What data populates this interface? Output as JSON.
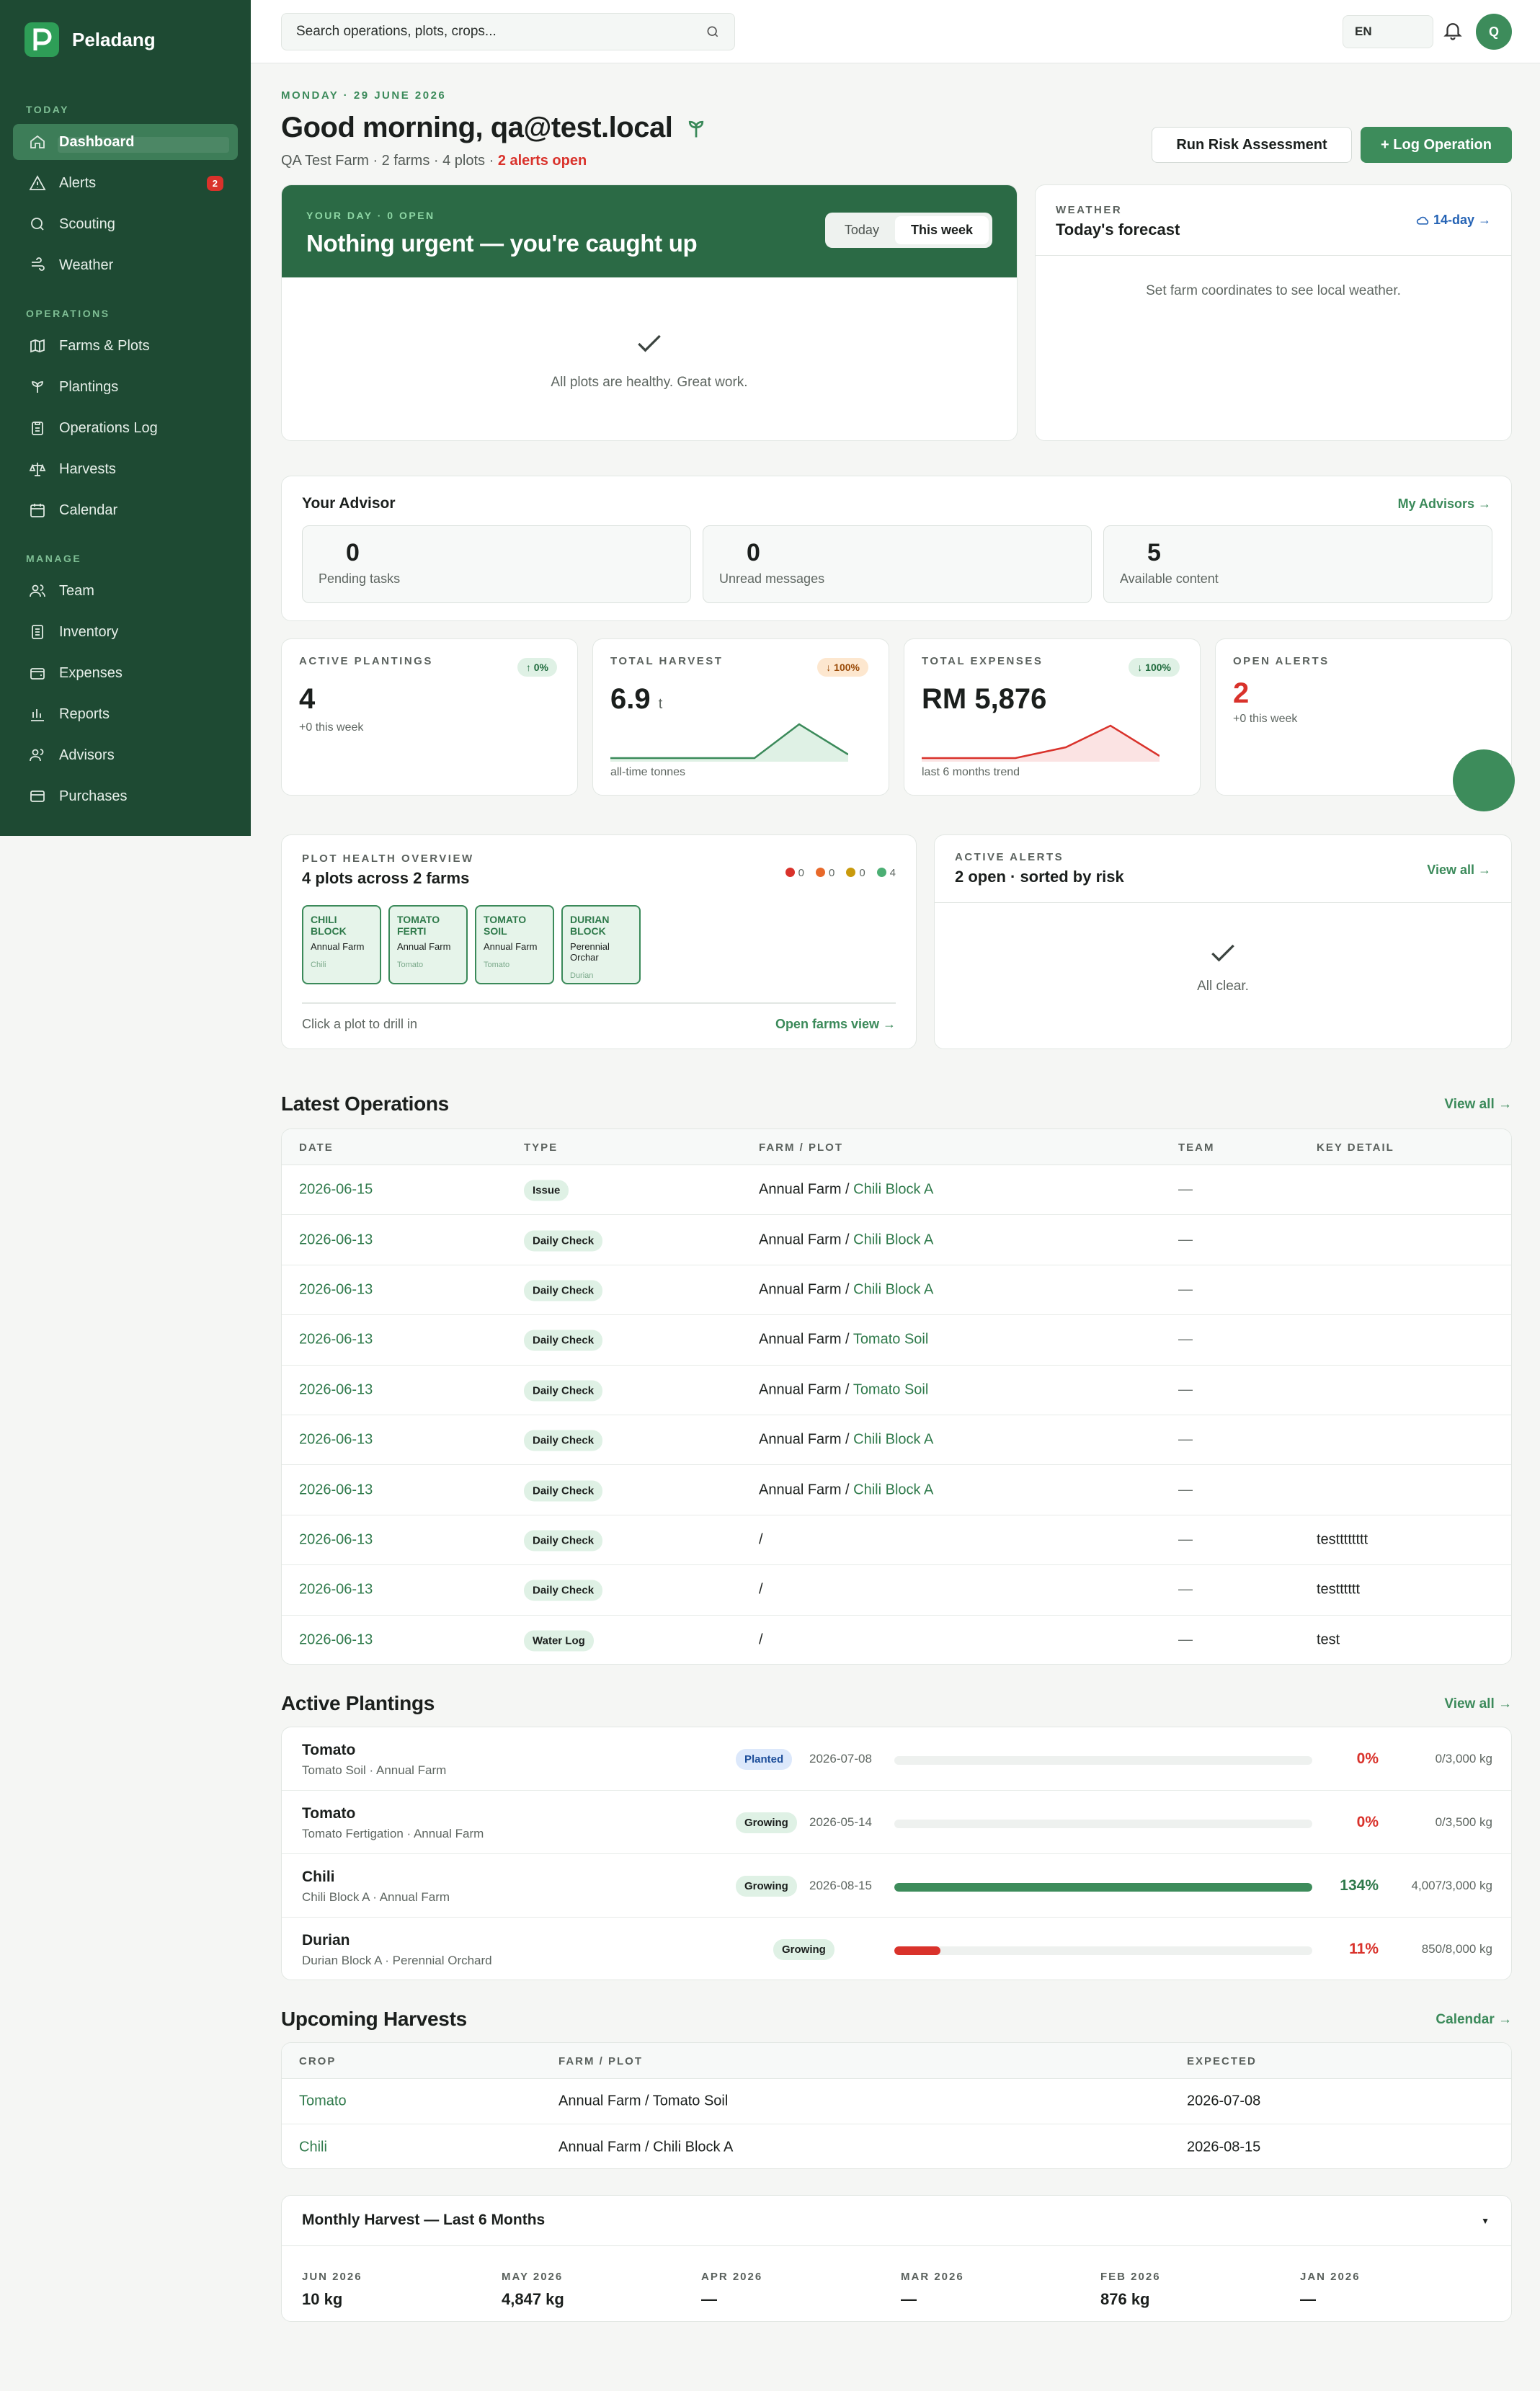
{
  "app": {
    "name": "Peladang"
  },
  "sidebar": {
    "sections": [
      {
        "label": "TODAY",
        "items": [
          {
            "label": "Dashboard",
            "icon": "home-icon",
            "active": true
          },
          {
            "label": "Alerts",
            "icon": "alert-triangle-icon",
            "badge": "2"
          },
          {
            "label": "Scouting",
            "icon": "search-icon"
          },
          {
            "label": "Weather",
            "icon": "weather-icon"
          }
        ]
      },
      {
        "label": "OPERATIONS",
        "items": [
          {
            "label": "Farms & Plots",
            "icon": "map-icon"
          },
          {
            "label": "Plantings",
            "icon": "sprout-icon"
          },
          {
            "label": "Operations Log",
            "icon": "clipboard-icon"
          },
          {
            "label": "Harvests",
            "icon": "scale-icon"
          },
          {
            "label": "Calendar",
            "icon": "calendar-icon"
          }
        ]
      },
      {
        "label": "MANAGE",
        "items": [
          {
            "label": "Team",
            "icon": "users-icon"
          },
          {
            "label": "Inventory",
            "icon": "inventory-icon"
          },
          {
            "label": "Expenses",
            "icon": "wallet-icon"
          },
          {
            "label": "Reports",
            "icon": "bar-chart-icon"
          },
          {
            "label": "Advisors",
            "icon": "advisor-icon"
          },
          {
            "label": "Purchases",
            "icon": "card-icon"
          }
        ]
      }
    ]
  },
  "topbar": {
    "search_placeholder": "Search operations, plots, crops...",
    "lang": "EN",
    "avatar": "Q"
  },
  "header": {
    "date": "MONDAY · 29 JUNE 2026",
    "greeting": "Good morning, qa@test.local",
    "subtitle": "QA Test Farm · 2 farms · 4 plots · ",
    "alerts_text": "2 alerts open",
    "run_risk": "Run Risk Assessment",
    "log_op": "+ Log Operation"
  },
  "your_day": {
    "eyebrow": "YOUR DAY · 0 OPEN",
    "title": "Nothing urgent — you're caught up",
    "toggle": [
      "Today",
      "This week"
    ],
    "empty": "All plots are healthy. Great work."
  },
  "weather": {
    "eyebrow": "WEATHER",
    "title": "Today's forecast",
    "link": "14-day →",
    "message": "Set farm coordinates to see local weather."
  },
  "advisor": {
    "title": "Your Advisor",
    "link": "My Advisors →",
    "stats": [
      {
        "value": "0",
        "label": "Pending tasks"
      },
      {
        "value": "0",
        "label": "Unread messages"
      },
      {
        "value": "5",
        "label": "Available content"
      }
    ]
  },
  "kpis": [
    {
      "label": "ACTIVE PLANTINGS",
      "value": "4",
      "note": "+0 this week",
      "pill": "↑ 0%"
    },
    {
      "label": "TOTAL HARVEST",
      "value": "6.9",
      "unit": "t",
      "note": "all-time tonnes",
      "pill": "↓ 100%"
    },
    {
      "label": "TOTAL EXPENSES",
      "value": "RM 5,876",
      "note": "last 6 months trend",
      "pill": "↓ 100%"
    },
    {
      "label": "OPEN ALERTS",
      "value": "2",
      "note": "+0 this week"
    }
  ],
  "plot_health": {
    "eyebrow": "PLOT HEALTH OVERVIEW",
    "title": "4 plots across 2 farms",
    "legend": [
      {
        "color": "#d9322b",
        "count": "0"
      },
      {
        "color": "#e8692a",
        "count": "0"
      },
      {
        "color": "#c99a0c",
        "count": "0"
      },
      {
        "color": "#4caf74",
        "count": "4"
      }
    ],
    "plots": [
      {
        "name": "CHILI BLOCK",
        "farm": "Annual Farm",
        "crop": "Chili"
      },
      {
        "name": "TOMATO FERTI",
        "farm": "Annual Farm",
        "crop": "Tomato"
      },
      {
        "name": "TOMATO SOIL",
        "farm": "Annual Farm",
        "crop": "Tomato"
      },
      {
        "name": "DURIAN BLOCK",
        "farm": "Perennial Orchar",
        "crop": "Durian"
      }
    ],
    "hint": "Click a plot to drill in",
    "link": "Open farms view →"
  },
  "active_alerts": {
    "eyebrow": "ACTIVE ALERTS",
    "title": "2 open · sorted by risk",
    "link": "View all →",
    "empty": "All clear."
  },
  "operations": {
    "title": "Latest Operations",
    "link": "View all →",
    "columns": [
      "DATE",
      "TYPE",
      "FARM / PLOT",
      "TEAM",
      "KEY DETAIL"
    ],
    "rows": [
      {
        "date": "2026-06-15",
        "type": "Issue",
        "farm": "Annual Farm",
        "plot": "Chili Block A",
        "team": "—",
        "detail": ""
      },
      {
        "date": "2026-06-13",
        "type": "Daily Check",
        "farm": "Annual Farm",
        "plot": "Chili Block A",
        "team": "—",
        "detail": ""
      },
      {
        "date": "2026-06-13",
        "type": "Daily Check",
        "farm": "Annual Farm",
        "plot": "Chili Block A",
        "team": "—",
        "detail": ""
      },
      {
        "date": "2026-06-13",
        "type": "Daily Check",
        "farm": "Annual Farm",
        "plot": "Tomato Soil",
        "team": "—",
        "detail": ""
      },
      {
        "date": "2026-06-13",
        "type": "Daily Check",
        "farm": "Annual Farm",
        "plot": "Tomato Soil",
        "team": "—",
        "detail": ""
      },
      {
        "date": "2026-06-13",
        "type": "Daily Check",
        "farm": "Annual Farm",
        "plot": "Chili Block A",
        "team": "—",
        "detail": ""
      },
      {
        "date": "2026-06-13",
        "type": "Daily Check",
        "farm": "Annual Farm",
        "plot": "Chili Block A",
        "team": "—",
        "detail": ""
      },
      {
        "date": "2026-06-13",
        "type": "Daily Check",
        "farm": "",
        "plot": "",
        "team": "—",
        "detail": "testttttttt"
      },
      {
        "date": "2026-06-13",
        "type": "Daily Check",
        "farm": "",
        "plot": "",
        "team": "—",
        "detail": "testttttt"
      },
      {
        "date": "2026-06-13",
        "type": "Water Log",
        "farm": "",
        "plot": "",
        "team": "—",
        "detail": "test"
      }
    ]
  },
  "plantings": {
    "title": "Active Plantings",
    "link": "View all →",
    "rows": [
      {
        "crop": "Tomato",
        "location": "Tomato Soil · Annual Farm",
        "status": "Planted",
        "date": "2026-07-08",
        "progress": 0,
        "pct": "0%",
        "qty": "0/3,000 kg"
      },
      {
        "crop": "Tomato",
        "location": "Tomato Fertigation · Annual Farm",
        "status": "Growing",
        "date": "2026-05-14",
        "progress": 0,
        "pct": "0%",
        "qty": "0/3,500 kg"
      },
      {
        "crop": "Chili",
        "location": "Chili Block A · Annual Farm",
        "status": "Growing",
        "date": "2026-08-15",
        "progress": 134,
        "pct": "134%",
        "qty": "4,007/3,000 kg"
      },
      {
        "crop": "Durian",
        "location": "Durian Block A · Perennial Orchard",
        "status": "Growing",
        "date": "",
        "progress": 11,
        "pct": "11%",
        "qty": "850/8,000 kg"
      }
    ]
  },
  "harvests": {
    "title": "Upcoming Harvests",
    "link": "Calendar →",
    "columns": [
      "CROP",
      "FARM / PLOT",
      "EXPECTED"
    ],
    "rows": [
      {
        "crop": "Tomato",
        "plot": "Annual Farm / Tomato Soil",
        "expected": "2026-07-08"
      },
      {
        "crop": "Chili",
        "plot": "Annual Farm / Chili Block A",
        "expected": "2026-08-15"
      }
    ]
  },
  "monthly": {
    "title": "Monthly Harvest — Last 6 Months",
    "caret": "▼",
    "months": [
      {
        "month": "JUN 2026",
        "value": "10 kg"
      },
      {
        "month": "MAY 2026",
        "value": "4,847 kg"
      },
      {
        "month": "APR 2026",
        "value": "—"
      },
      {
        "month": "MAR 2026",
        "value": "—"
      },
      {
        "month": "FEB 2026",
        "value": "876 kg"
      },
      {
        "month": "JAN 2026",
        "value": "—"
      }
    ]
  },
  "colors": {
    "brand": "#1e4a33",
    "accent": "#3d8c5b",
    "danger": "#d9322b"
  }
}
